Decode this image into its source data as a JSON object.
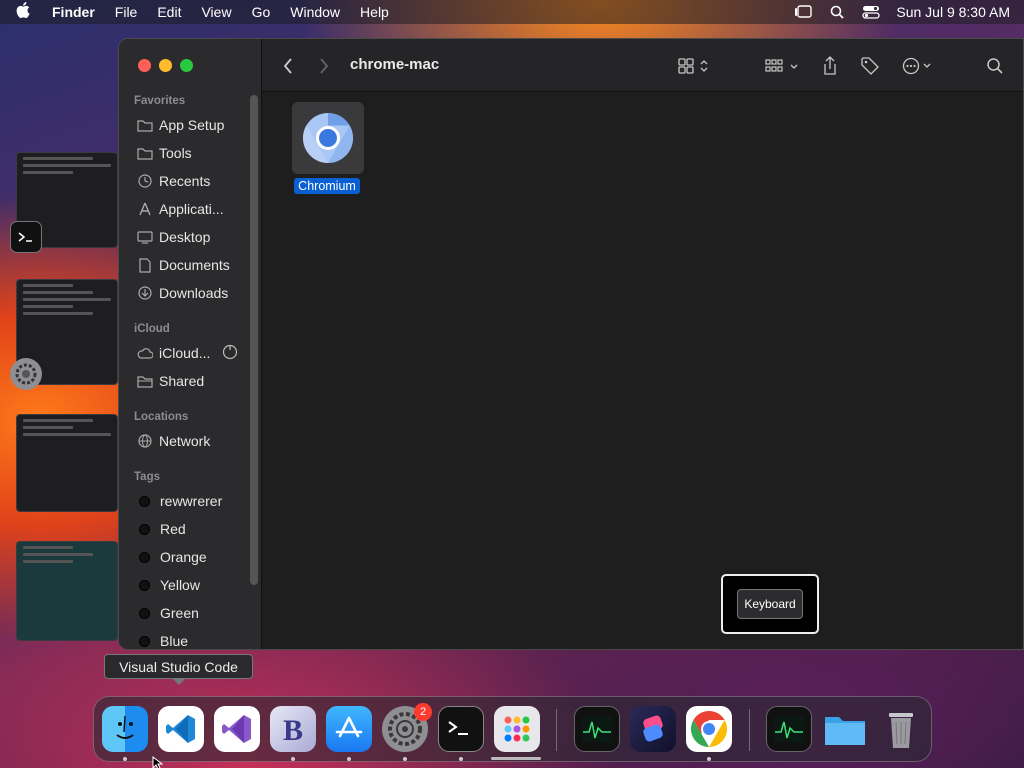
{
  "menubar": {
    "apple_icon": "apple-logo",
    "app_name": "Finder",
    "menus": [
      "File",
      "Edit",
      "View",
      "Go",
      "Window",
      "Help"
    ],
    "clock": "Sun Jul 9  8:30 AM"
  },
  "finder": {
    "title": "chrome-mac",
    "sidebar": {
      "favorites_label": "Favorites",
      "favorites": [
        "App Setup",
        "Tools",
        "Recents",
        "Applicati...",
        "Desktop",
        "Documents",
        "Downloads"
      ],
      "icloud_label": "iCloud",
      "icloud": [
        "iCloud...",
        "Shared"
      ],
      "locations_label": "Locations",
      "locations": [
        "Network"
      ],
      "tags_label": "Tags",
      "tags": [
        "rewwrerer",
        "Red",
        "Orange",
        "Yellow",
        "Green",
        "Blue"
      ]
    },
    "files": [
      {
        "name": "Chromium",
        "icon": "chromium-icon"
      }
    ]
  },
  "keyboard_panel": {
    "button_label": "Keyboard"
  },
  "tooltip": "Visual Studio Code",
  "dock": {
    "badge_system_settings": "2",
    "apps": [
      "Finder",
      "Visual Studio Code",
      "Visual Studio",
      "BBEdit",
      "App Store",
      "System Settings",
      "Terminal",
      "Launchpad",
      "Activity Monitor",
      "Shortcuts",
      "Google Chrome",
      "Activity Monitor",
      "Downloads Folder",
      "Trash"
    ]
  },
  "colors": {
    "selection_blue": "#0a5fd2",
    "window_bg": "#1e1e1e",
    "sidebar_bg": "#2b2b2d"
  }
}
